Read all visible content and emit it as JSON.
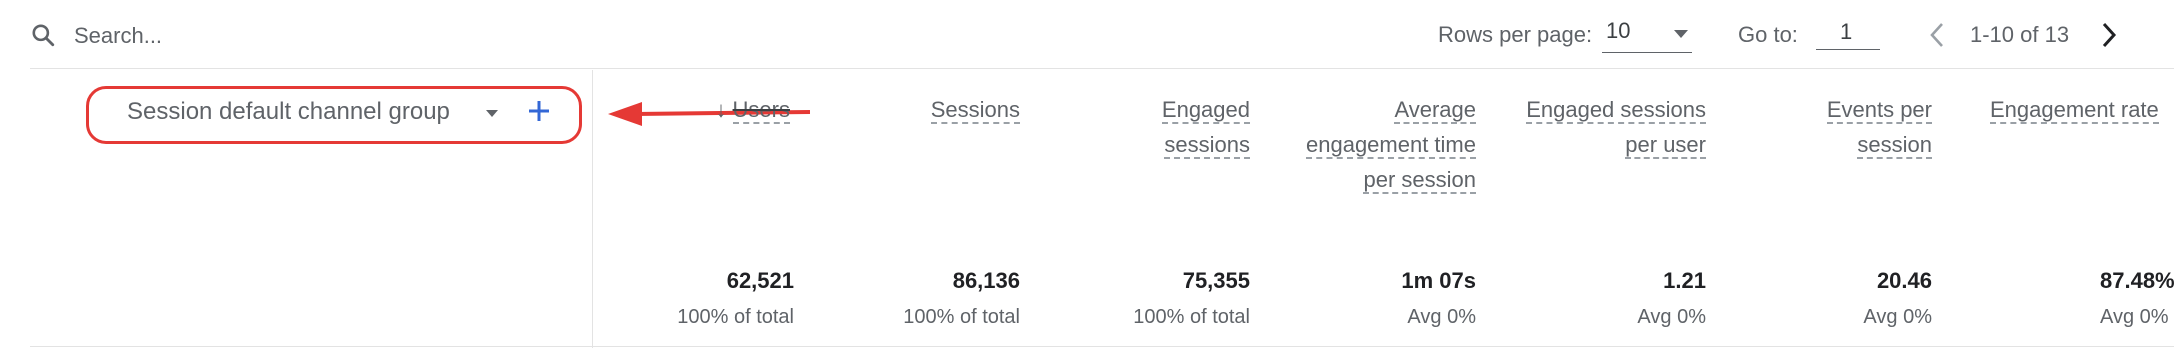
{
  "toolbar": {
    "search_placeholder": "Search...",
    "rows_per_page_label": "Rows per page:",
    "rows_per_page_value": "10",
    "go_to_label": "Go to:",
    "go_to_value": "1",
    "range_text": "1-10 of 13"
  },
  "dimension": {
    "label": "Session default channel group"
  },
  "columns": [
    {
      "label": "Users",
      "sorted": "descending"
    },
    {
      "label": "Sessions"
    },
    {
      "label": "Engaged sessions"
    },
    {
      "label": "Average engagement time per session"
    },
    {
      "label": "Engaged sessions per user"
    },
    {
      "label": "Events per session"
    },
    {
      "label": "Engagement rate"
    }
  ],
  "totals": [
    {
      "value": "62,521",
      "sub": "100% of total"
    },
    {
      "value": "86,136",
      "sub": "100% of total"
    },
    {
      "value": "75,355",
      "sub": "100% of total"
    },
    {
      "value": "1m 07s",
      "sub": "Avg 0%"
    },
    {
      "value": "1.21",
      "sub": "Avg 0%"
    },
    {
      "value": "20.46",
      "sub": "Avg 0%"
    },
    {
      "value": "87.48%",
      "sub": "Avg 0%"
    }
  ],
  "icons": {
    "search": "search-icon",
    "add": "plus-icon",
    "prev": "chevron-left-icon",
    "next": "chevron-right-icon",
    "sort": "arrow-down-icon"
  },
  "colors": {
    "highlight": "#e53935",
    "add_button": "#3367d6",
    "text": "#3c4043"
  }
}
